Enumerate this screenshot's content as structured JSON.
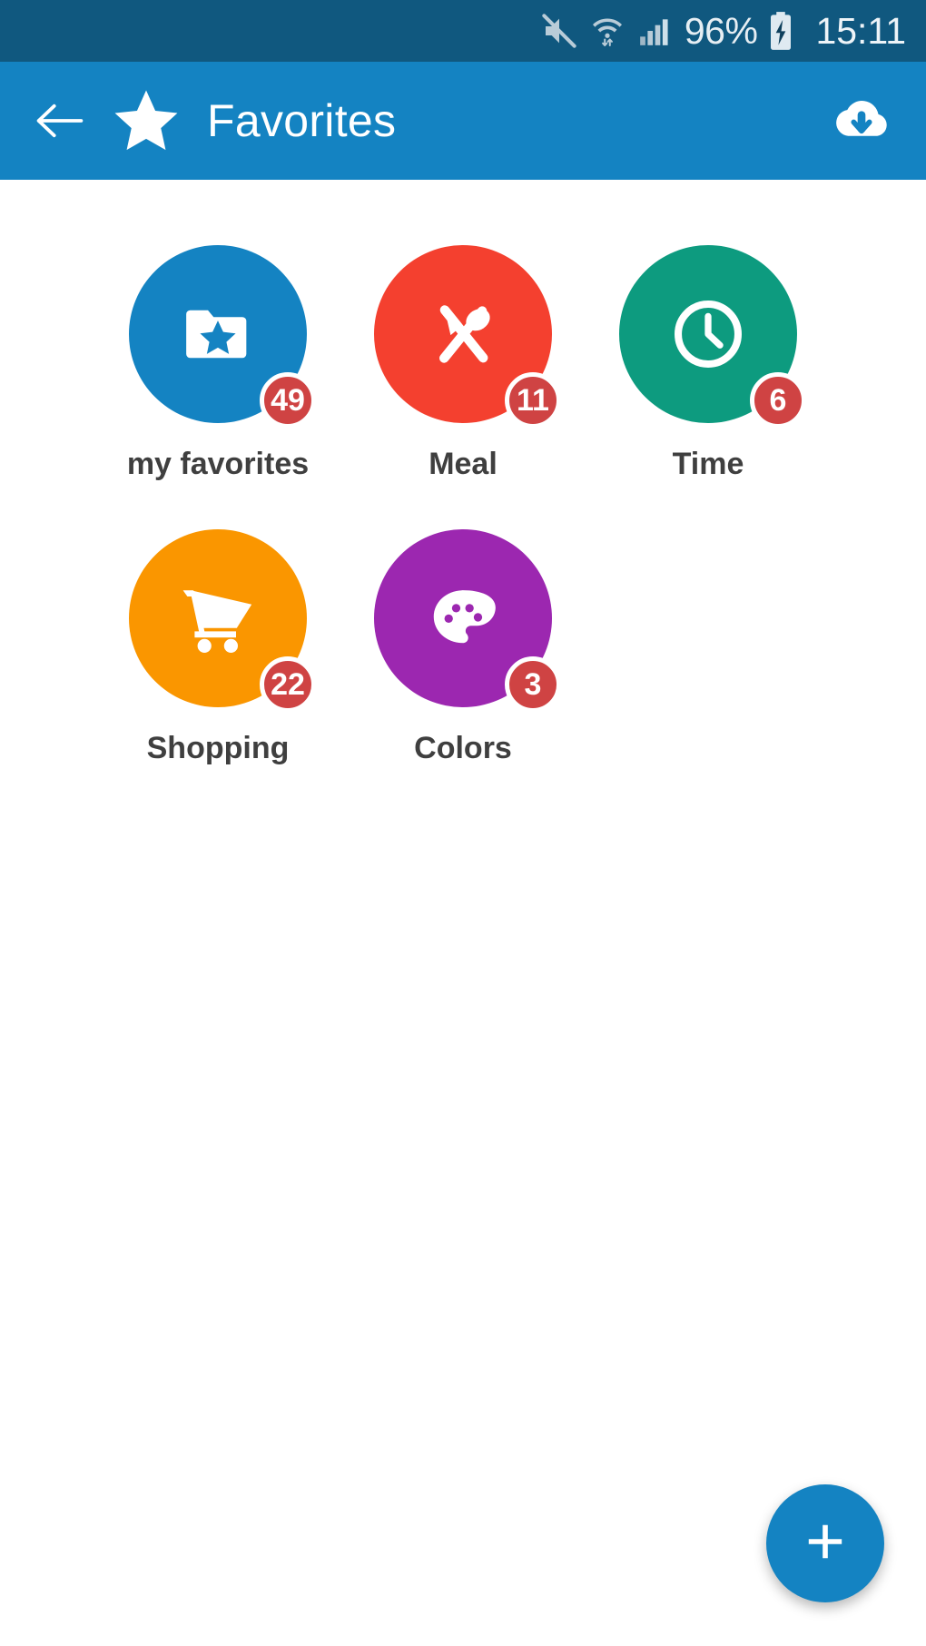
{
  "status_bar": {
    "background": "#10587f",
    "mute_icon": "speaker-mute-icon",
    "wifi_icon": "wifi-icon",
    "signal_icon": "cellular-signal-icon",
    "battery_percent": "96%",
    "battery_icon": "battery-charging-icon",
    "time": "15:11"
  },
  "app_bar": {
    "background": "#1483c2",
    "back_icon": "back-arrow-icon",
    "logo_icon": "star-icon",
    "title": "Favorites",
    "action_icon": "cloud-download-icon"
  },
  "grid": {
    "items": [
      {
        "label": "my favorites",
        "badge": "49",
        "color": "#1483c2",
        "icon": "folder-star-icon"
      },
      {
        "label": "Meal",
        "badge": "11",
        "color": "#f4402f",
        "icon": "fork-spoon-icon"
      },
      {
        "label": "Time",
        "badge": "6",
        "color": "#0d9b7f",
        "icon": "clock-icon"
      },
      {
        "label": "Shopping",
        "badge": "22",
        "color": "#fa9600",
        "icon": "shopping-cart-icon"
      },
      {
        "label": "Colors",
        "badge": "3",
        "color": "#9c27b0",
        "icon": "palette-icon"
      }
    ],
    "badge_color": "#cf4343",
    "label_color": "#3f3f3f"
  },
  "fab": {
    "icon": "plus-icon",
    "color": "#1483c2"
  }
}
